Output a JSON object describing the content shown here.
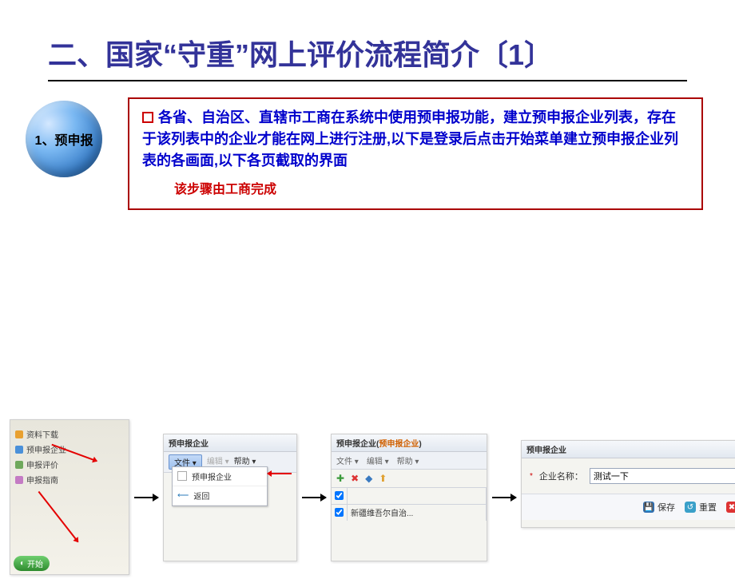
{
  "slide": {
    "title": "二、国家“守重”网上评价流程简介〔1〕",
    "sphere_label": "1、预申报",
    "paragraph": "各省、自治区、直辖市工商在系统中使用预申报功能，建立预申报企业列表，存在于该列表中的企业才能在网上进行注册,以下是登录后点击开始菜单建立预申报企业列表的各画面,以下各页截取的界面",
    "red_note": "该步骤由工商完成"
  },
  "shot1": {
    "items": [
      "资料下载",
      "预申报企业",
      "申报评价",
      "申报指南"
    ],
    "start": "开始"
  },
  "shot2": {
    "title": "预申报企业",
    "menu": {
      "file": "文件",
      "edit": "编辑",
      "help": "帮助"
    },
    "dropdown": {
      "item1": "预申报企业",
      "item2": "返回"
    }
  },
  "shot3": {
    "title_prefix": "预申报企业(",
    "title_hl": "预申报企业",
    "title_suffix": ")",
    "menu": {
      "file": "文件",
      "edit": "编辑",
      "help": "帮助"
    },
    "row1": "新疆维吾尔自治..."
  },
  "shot4": {
    "title": "预申报企业",
    "label": "企业名称：",
    "value": "测试一下",
    "buttons": {
      "save": "保存",
      "reset": "重置",
      "cancel": "取消"
    }
  }
}
